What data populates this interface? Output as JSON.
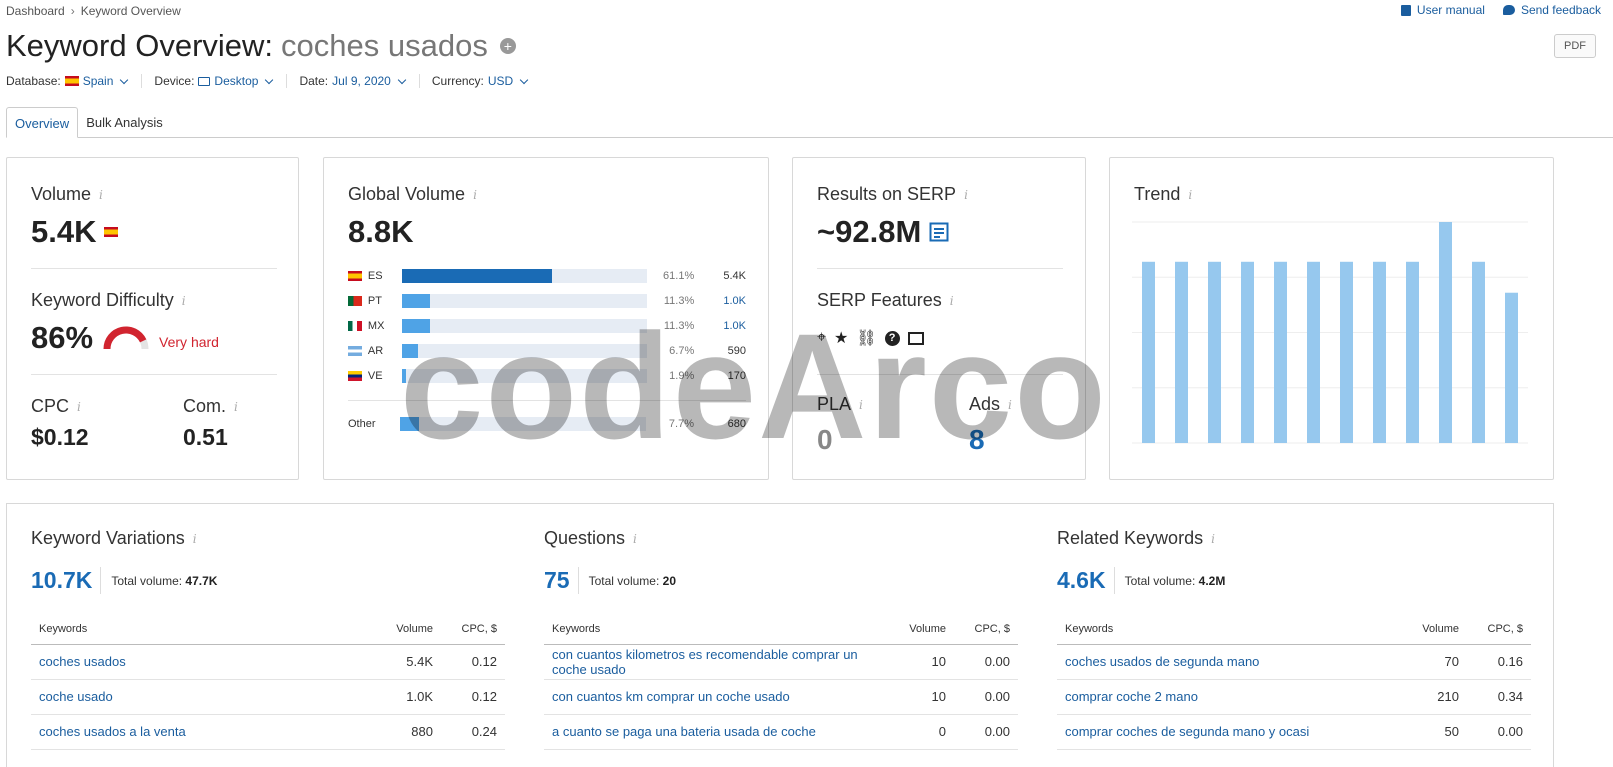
{
  "breadcrumb": {
    "root": "Dashboard",
    "current": "Keyword Overview"
  },
  "links": {
    "manual": "User manual",
    "feedback": "Send feedback"
  },
  "header": {
    "title": "Keyword Overview:",
    "keyword": "coches usados",
    "pdf": "PDF"
  },
  "filters": {
    "database_label": "Database:",
    "database": "Spain",
    "device_label": "Device:",
    "device": "Desktop",
    "date_label": "Date:",
    "date": "Jul 9, 2020",
    "currency_label": "Currency:",
    "currency": "USD"
  },
  "tabs": [
    "Overview",
    "Bulk Analysis"
  ],
  "volume": {
    "label": "Volume",
    "value": "5.4K"
  },
  "difficulty": {
    "label": "Keyword Difficulty",
    "value": "86%",
    "text": "Very hard",
    "color": "#d1242f"
  },
  "cpc": {
    "label": "CPC",
    "value": "$0.12"
  },
  "com": {
    "label": "Com.",
    "value": "0.51"
  },
  "global": {
    "label": "Global Volume",
    "value": "8.8K",
    "rows": [
      {
        "code": "ES",
        "pct": "61.1%",
        "num": "5.4K",
        "share": 0.611
      },
      {
        "code": "PT",
        "pct": "11.3%",
        "num": "1.0K",
        "share": 0.113
      },
      {
        "code": "MX",
        "pct": "11.3%",
        "num": "1.0K",
        "share": 0.113
      },
      {
        "code": "AR",
        "pct": "6.7%",
        "num": "590",
        "share": 0.067
      },
      {
        "code": "VE",
        "pct": "1.9%",
        "num": "170",
        "share": 0.019
      }
    ],
    "other": {
      "code": "Other",
      "pct": "7.7%",
      "num": "680",
      "share": 0.077
    }
  },
  "serp": {
    "label": "Results on SERP",
    "value": "~92.8M",
    "features_label": "SERP Features",
    "features": [
      "pin-icon",
      "star-icon",
      "link-icon",
      "question-icon",
      "news-icon"
    ]
  },
  "pla": {
    "label": "PLA",
    "value": "0"
  },
  "ads": {
    "label": "Ads",
    "value": "8"
  },
  "trend": {
    "label": "Trend"
  },
  "chart_data": {
    "type": "bar",
    "title": "Trend",
    "values": [
      0.82,
      0.82,
      0.82,
      0.82,
      0.82,
      0.82,
      0.82,
      0.82,
      0.82,
      1.0,
      0.82,
      0.68
    ]
  },
  "variations": {
    "label": "Keyword Variations",
    "count": "10.7K",
    "total_label": "Total volume:",
    "total": "47.7K",
    "headers": [
      "Keywords",
      "Volume",
      "CPC, $"
    ],
    "rows": [
      {
        "kw": "coches usados",
        "vol": "5.4K",
        "cpc": "0.12"
      },
      {
        "kw": "coche usado",
        "vol": "1.0K",
        "cpc": "0.12"
      },
      {
        "kw": "coches usados a la venta",
        "vol": "880",
        "cpc": "0.24"
      }
    ]
  },
  "questions": {
    "label": "Questions",
    "count": "75",
    "total_label": "Total volume:",
    "total": "20",
    "headers": [
      "Keywords",
      "Volume",
      "CPC, $"
    ],
    "rows": [
      {
        "kw": "con cuantos kilometros es recomendable comprar un coche usado",
        "vol": "10",
        "cpc": "0.00"
      },
      {
        "kw": "con cuantos km comprar un coche usado",
        "vol": "10",
        "cpc": "0.00"
      },
      {
        "kw": "a cuanto se paga una bateria usada de coche",
        "vol": "0",
        "cpc": "0.00"
      }
    ]
  },
  "related": {
    "label": "Related Keywords",
    "count": "4.6K",
    "total_label": "Total volume:",
    "total": "4.2M",
    "headers": [
      "Keywords",
      "Volume",
      "CPC, $"
    ],
    "rows": [
      {
        "kw": "coches usados de segunda mano",
        "vol": "70",
        "cpc": "0.16"
      },
      {
        "kw": "comprar coche 2 mano",
        "vol": "210",
        "cpc": "0.34"
      },
      {
        "kw": "comprar coches de segunda mano y ocasi",
        "vol": "50",
        "cpc": "0.00"
      }
    ]
  },
  "watermark": "codeArco"
}
